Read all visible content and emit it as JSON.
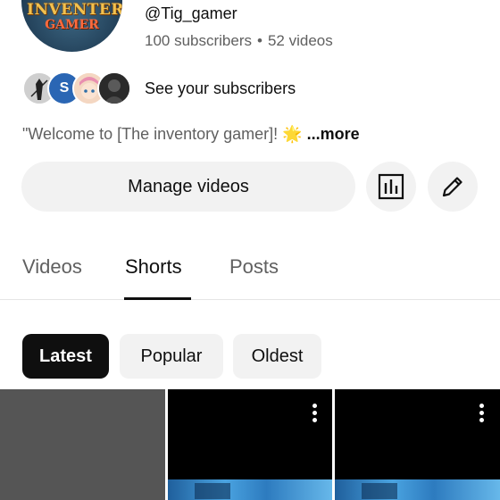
{
  "channel": {
    "logo_line1": "INVENTERY",
    "logo_line2": "GAMER",
    "handle": "@Tig_gamer",
    "subscribers": "100 subscribers",
    "separator": "•",
    "videos": "52 videos",
    "subscriber_avatar_letter": "S",
    "see_subscribers": "See your subscribers",
    "description": "\"Welcome to [The inventory gamer]! 🌟",
    "more_label": "...more"
  },
  "actions": {
    "manage_videos": "Manage videos",
    "analytics_icon": "bar-chart-icon",
    "edit_icon": "pencil-icon"
  },
  "tabs": [
    {
      "label": "Videos",
      "selected": false
    },
    {
      "label": "Shorts",
      "selected": true
    },
    {
      "label": "Posts",
      "selected": false
    }
  ],
  "filters": [
    {
      "label": "Latest",
      "selected": true
    },
    {
      "label": "Popular",
      "selected": false
    },
    {
      "label": "Oldest",
      "selected": false
    }
  ],
  "colors": {
    "text_primary": "#0f0f0f",
    "text_secondary": "#606060",
    "chip_bg": "#f2f2f2",
    "chip_selected_bg": "#0f0f0f"
  }
}
